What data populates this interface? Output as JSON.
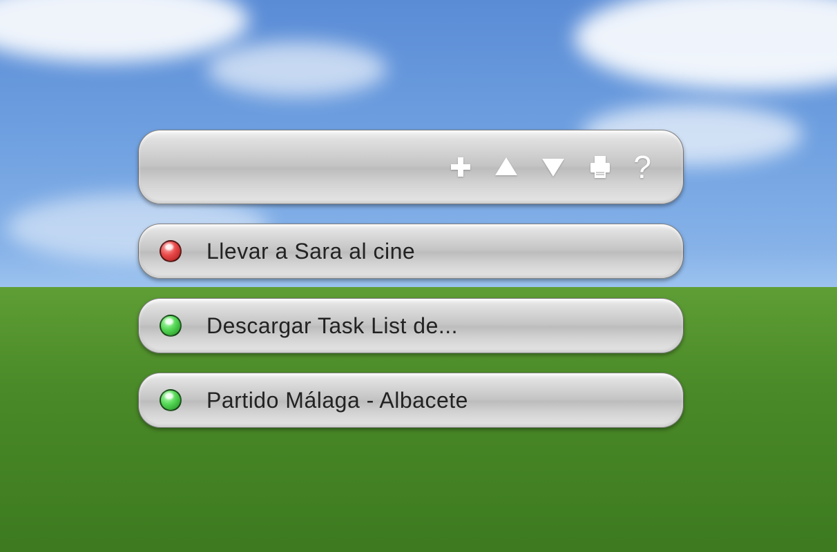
{
  "toolbar": {
    "add": "add",
    "up": "move-up",
    "down": "move-down",
    "print": "print",
    "help": "?"
  },
  "tasks": [
    {
      "status": "red",
      "label": "Llevar a Sara al cine"
    },
    {
      "status": "green",
      "label": "Descargar Task List de..."
    },
    {
      "status": "green",
      "label": "Partido Málaga - Albacete"
    }
  ],
  "colors": {
    "red": "#e84848",
    "green": "#54d654"
  }
}
